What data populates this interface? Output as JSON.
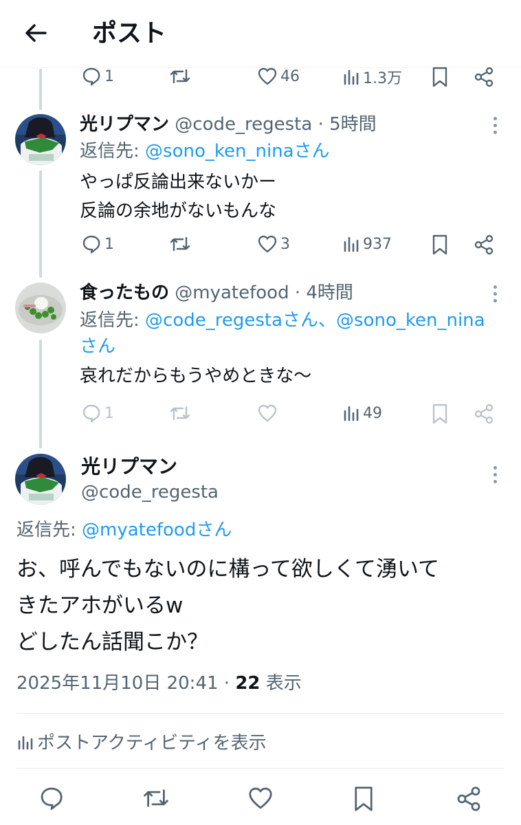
{
  "header": {
    "title": "ポスト"
  },
  "top_actions": {
    "replies": "1",
    "likes": "46",
    "views": "1.3万"
  },
  "tweets": [
    {
      "name": "光リプマン",
      "handle": "@code_regesta",
      "time": "· 5時間",
      "reply_label": "返信先: ",
      "reply_to": "@sono_ken_ninaさん",
      "lines": [
        "やっぱ反論出来ないかー",
        "反論の余地がないもんな"
      ],
      "replies": "1",
      "likes": "3",
      "views": "937"
    },
    {
      "name": "食ったもの",
      "handle": "@myatefood",
      "time": "· 4時間",
      "reply_label": "返信先: ",
      "reply_to_1": "@code_regestaさん、@sono_ken_nina",
      "reply_to_2": "さん",
      "lines": [
        "哀れだからもうやめときな〜"
      ],
      "replies": "1",
      "views": "49"
    }
  ],
  "main": {
    "name": "光リプマン",
    "handle": "@code_regesta",
    "reply_label": "返信先: ",
    "reply_to": "@myatefoodさん",
    "lines": [
      "お、呼んでもないのに構って欲しくて湧いて",
      "きたアホがいるw",
      "どしたん話聞こか？"
    ],
    "date": "2025年11月10日 20:41 · ",
    "view_count": "22",
    "view_label": " 表示",
    "activity": "ポストアクティビティを表示"
  }
}
